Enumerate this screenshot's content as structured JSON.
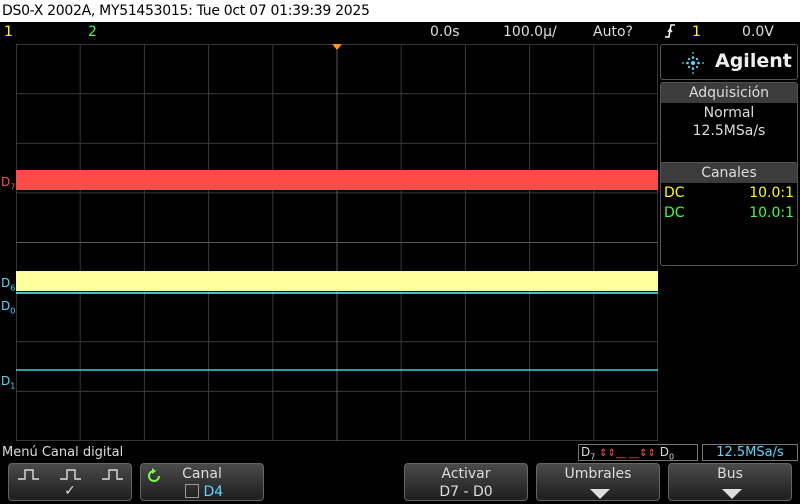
{
  "title_bar": "DS0-X 2002A, MY51453015: Tue 0ct 07 01:39:39 2025",
  "status": {
    "ch1": "1",
    "ch2": "2",
    "time_offset": "0.0s",
    "timebase": "100.0µ/",
    "trigger_mode": "Auto?",
    "trigger_slope_icon": "rising-edge-icon",
    "trigger_source": "1",
    "trigger_level": "0.0V"
  },
  "brand": "Agilent",
  "acquisition": {
    "title": "Adquisición",
    "mode": "Normal",
    "rate": "12.5MSa/s"
  },
  "channels": {
    "title": "Canales",
    "rows": [
      {
        "coupling": "DC",
        "probe": "10.0:1",
        "color": "#ffff00"
      },
      {
        "coupling": "DC",
        "probe": "10.0:1",
        "color": "#40ff40"
      }
    ]
  },
  "trace_labels": {
    "d7": "D",
    "d7_sub": "7",
    "d6": "D",
    "d6_sub": "6",
    "d0": "D",
    "d0_sub": "0",
    "d1": "D",
    "d1_sub": "1"
  },
  "menu_label": "Menú Canal digital",
  "bus_readout": {
    "left": "D",
    "left_sub": "7",
    "pattern": "⇕⇕__ __⇕⇕",
    "right": "D",
    "right_sub": "0",
    "rate": "12.5MSa/s"
  },
  "softkeys": {
    "thresholds_check": "✓",
    "channel_label": "Canal",
    "channel_value": "D4",
    "activate_label": "Activar",
    "activate_value": "D7 - D0",
    "thresholds_label": "Umbrales",
    "bus_label": "Bus"
  },
  "colors": {
    "d7_trace": "#ff4a4a",
    "d6_trace": "#ffff99",
    "digital_line": "#3cffff",
    "accent_cyan": "#5ad8ff",
    "trigger_marker": "#ff9900"
  }
}
